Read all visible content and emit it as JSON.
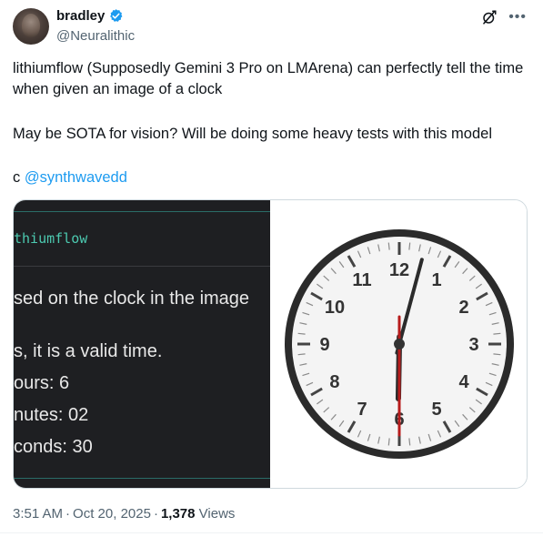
{
  "author": {
    "display_name": "bradley",
    "handle": "@Neuralithic",
    "verified": true
  },
  "tweet": {
    "paragraph1": "lithiumflow (Supposedly Gemini 3 Pro on LMArena) can perfectly tell the time when given an image of a clock",
    "paragraph2": "May be SOTA for vision? Will be doing some heavy tests with this model",
    "credit_prefix": "c ",
    "credit_mention": "@synthwavedd"
  },
  "media": {
    "left": {
      "title": "thiumflow",
      "lines": [
        "sed on the clock in the image",
        "s, it is a valid time.",
        "ours: 6",
        "nutes: 02",
        "conds: 30"
      ]
    },
    "clock": {
      "numbers": [
        "12",
        "1",
        "2",
        "3",
        "4",
        "5",
        "6",
        "7",
        "8",
        "9",
        "10",
        "11"
      ],
      "hour": 6,
      "minute": 2,
      "second": 30
    }
  },
  "meta": {
    "time": "3:51 AM",
    "date": "Oct 20, 2025",
    "views_count": "1,378",
    "views_label": "Views"
  },
  "colors": {
    "accent": "#1d9bf0",
    "secondary_text": "#536471",
    "terminal_bg": "#1e1f22",
    "terminal_accent": "#4cc9b0"
  },
  "icons": [
    "verified-badge-icon",
    "grok-icon",
    "more-options-icon"
  ]
}
